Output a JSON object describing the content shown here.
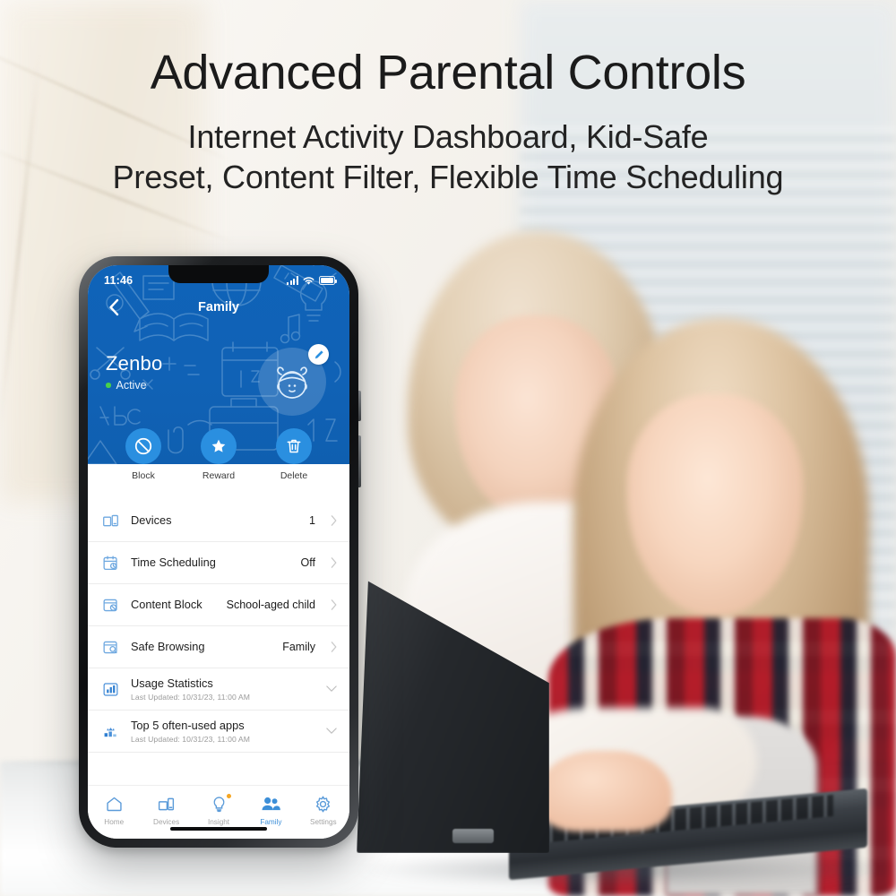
{
  "promo": {
    "title": "Advanced Parental Controls",
    "subtitle": "Internet Activity Dashboard, Kid-Safe\nPreset, Content Filter, Flexible Time Scheduling"
  },
  "colors": {
    "brand_blue": "#0f63b8",
    "action_blue": "#2a8fe0",
    "accent_icon": "#3d8fd8",
    "active_dot": "#48d14a",
    "badge_orange": "#f5a623"
  },
  "phone": {
    "statusbar": {
      "time": "11:46",
      "signal": "signal-icon",
      "wifi": "wifi-icon",
      "battery": "battery-icon"
    },
    "navbar": {
      "back": "chevron-left-icon",
      "title": "Family"
    },
    "profile": {
      "name": "Zenbo",
      "status": "Active",
      "avatar": "kid-avatar",
      "edit": "pencil-icon"
    },
    "actions": [
      {
        "label": "Block",
        "icon": "block-icon"
      },
      {
        "label": "Reward",
        "icon": "star-icon"
      },
      {
        "label": "Delete",
        "icon": "trash-icon"
      }
    ],
    "list": [
      {
        "label": "Devices",
        "value": "1",
        "sub": "",
        "icon": "devices-icon",
        "accessory": "chevron"
      },
      {
        "label": "Time Scheduling",
        "value": "Off",
        "sub": "",
        "icon": "calendar-clock-icon",
        "accessory": "chevron"
      },
      {
        "label": "Content Block",
        "value": "School-aged child",
        "sub": "",
        "icon": "content-block-icon",
        "accessory": "chevron"
      },
      {
        "label": "Safe Browsing",
        "value": "Family",
        "sub": "",
        "icon": "safe-browsing-icon",
        "accessory": "chevron"
      },
      {
        "label": "Usage Statistics",
        "value": "",
        "sub": "Last Updated: 10/31/23, 11:00 AM",
        "icon": "bar-chart-icon",
        "accessory": "caret"
      },
      {
        "label": "Top 5 often-used apps",
        "value": "",
        "sub": "Last Updated: 10/31/23, 11:00 AM",
        "icon": "podium-icon",
        "accessory": "caret"
      }
    ],
    "tabs": [
      {
        "label": "Home",
        "icon": "home-icon",
        "active": false,
        "badge": false
      },
      {
        "label": "Devices",
        "icon": "devices-icon",
        "active": false,
        "badge": false
      },
      {
        "label": "Insight",
        "icon": "bulb-icon",
        "active": false,
        "badge": true
      },
      {
        "label": "Family",
        "icon": "family-icon",
        "active": true,
        "badge": false
      },
      {
        "label": "Settings",
        "icon": "gear-icon",
        "active": false,
        "badge": false
      }
    ]
  }
}
